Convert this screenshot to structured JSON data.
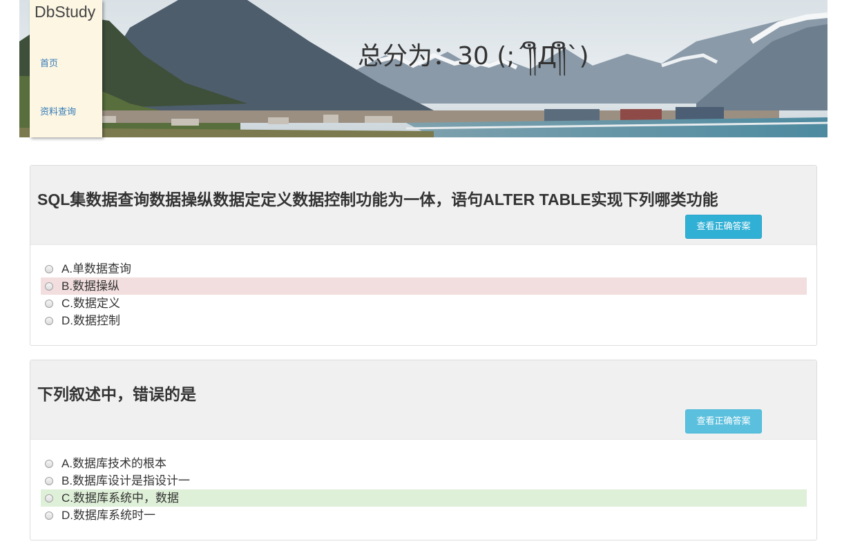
{
  "app": {
    "brand": "DbStudy",
    "score_text": "总分为：30 (;´༎ຶД༎ຶ`)"
  },
  "nav": {
    "items": [
      {
        "label": "首页"
      },
      {
        "label": "资料查询"
      }
    ]
  },
  "questions": [
    {
      "title": "SQL集数据查询数据操纵数据定定义数据控制功能为一体，语句ALTER TABLE实现下列哪类功能",
      "button_label": "查看正确答案",
      "options": [
        {
          "label": "A.单数据查询",
          "state": "none"
        },
        {
          "label": "B.数据操纵",
          "state": "wrong"
        },
        {
          "label": "C.数据定义",
          "state": "none"
        },
        {
          "label": "D.数据控制",
          "state": "none"
        }
      ]
    },
    {
      "title": "下列叙述中，错误的是",
      "button_label": "查看正确答案",
      "options": [
        {
          "label": "A.数据库技术的根本",
          "state": "none"
        },
        {
          "label": "B.数据库设计是指设计一",
          "state": "none"
        },
        {
          "label": "C.数据库系统中，数据",
          "state": "correct"
        },
        {
          "label": "D.数据库系统时一",
          "state": "none"
        }
      ]
    }
  ],
  "colors": {
    "wrong_highlight": "#f2dede",
    "correct_highlight": "#dff0d8",
    "button": "#31b0d5",
    "link": "#337ab7"
  }
}
